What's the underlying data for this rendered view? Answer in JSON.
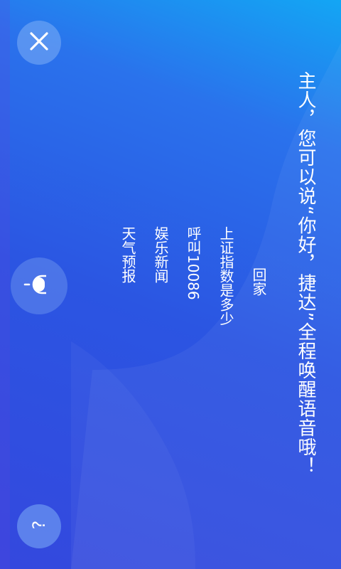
{
  "prompt": {
    "text": "主人，您可以说“你好，捷达”全程唤醒语音哦！"
  },
  "examples": [
    "回家",
    "上证指数是多少",
    "呼叫10086",
    "娱乐新闻",
    "天气预报"
  ],
  "icons": {
    "close": "close-icon",
    "mic": "microphone-icon",
    "help": "question-mark-icon"
  },
  "colors": {
    "gradient_top": "#13a6f4",
    "gradient_bottom": "#3448de",
    "text": "#ffffff"
  }
}
